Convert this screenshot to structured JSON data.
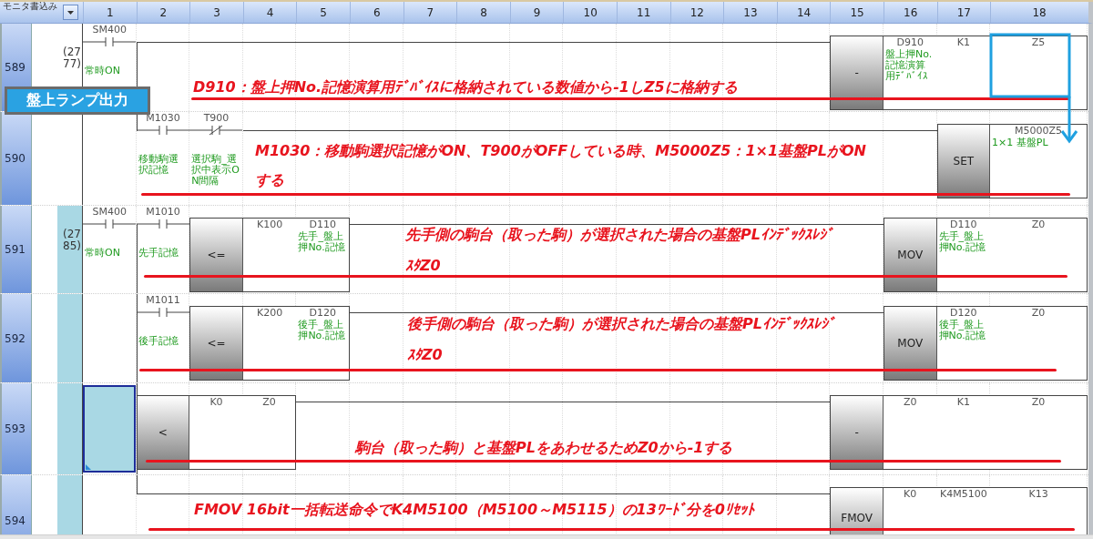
{
  "header": {
    "mode_label": "モニタ書込み",
    "columns": [
      "1",
      "2",
      "3",
      "4",
      "5",
      "6",
      "7",
      "8",
      "9",
      "10",
      "11",
      "12",
      "13",
      "14",
      "15",
      "16",
      "17",
      "18"
    ]
  },
  "section_label": "盤上ランプ出力",
  "rungs": [
    {
      "number": "589",
      "step": "(2777)",
      "step_band": false,
      "cursor": false,
      "joins_previous": false,
      "elements": [
        {
          "kind": "contact",
          "device": "SM400",
          "comment": "常時ON",
          "normally_closed": false
        },
        {
          "kind": "instruction",
          "op": "-",
          "operands": [
            {
              "device": "D910",
              "comment": "盤上押No.記憶演算用ﾃﾞﾊﾞｲｽ"
            },
            {
              "device": "K1"
            },
            {
              "device": "Z5"
            }
          ]
        }
      ],
      "note": [
        "D910：盤上押No.記憶演算用ﾃﾞﾊﾞｲｽに格納されている数値から-1しZ5に格納する"
      ]
    },
    {
      "number": "590",
      "step_band": false,
      "cursor": false,
      "joins_previous": true,
      "elements": [
        {
          "kind": "contact",
          "device": "M1030",
          "comment": "移動駒選択記憶",
          "normally_closed": false
        },
        {
          "kind": "contact",
          "device": "T900",
          "comment": "選択駒_選択中表示ON間隔",
          "normally_closed": true
        },
        {
          "kind": "instruction",
          "op": "SET",
          "operands": [
            {
              "device": "M5000Z5",
              "comment": "1×1 基盤PL"
            }
          ]
        }
      ],
      "note": [
        "M1030：移動駒選択記憶がON、T900がOFFしている時、M5000Z5：1×1基盤PLがON",
        "する"
      ]
    },
    {
      "number": "591",
      "step": "(2785)",
      "step_band": true,
      "cursor": false,
      "joins_previous": false,
      "elements": [
        {
          "kind": "contact",
          "device": "SM400",
          "comment": "常時ON",
          "normally_closed": false
        },
        {
          "kind": "contact",
          "device": "M1010",
          "comment": "先手記憶",
          "normally_closed": false
        },
        {
          "kind": "instruction",
          "op": "<=",
          "operands": [
            {
              "device": "K100"
            },
            {
              "device": "D110",
              "comment": "先手_盤上押No.記憶"
            }
          ]
        },
        {
          "kind": "instruction",
          "op": "MOV",
          "operands": [
            {
              "device": "D110",
              "comment": "先手_盤上押No.記憶"
            },
            {
              "device": "Z0"
            }
          ]
        }
      ],
      "note": [
        "先手側の駒台（取った駒）が選択された場合の基盤PLｲﾝﾃﾞｯｸｽﾚｼﾞ",
        "ｽﾀZ0"
      ]
    },
    {
      "number": "592",
      "step_band": true,
      "cursor": false,
      "joins_previous": true,
      "elements": [
        {
          "kind": "contact",
          "device": "M1011",
          "comment": "後手記憶",
          "normally_closed": false
        },
        {
          "kind": "instruction",
          "op": "<=",
          "operands": [
            {
              "device": "K200"
            },
            {
              "device": "D120",
              "comment": "後手_盤上押No.記憶"
            }
          ]
        },
        {
          "kind": "instruction",
          "op": "MOV",
          "operands": [
            {
              "device": "D120",
              "comment": "後手_盤上押No.記憶"
            },
            {
              "device": "Z0"
            }
          ]
        }
      ],
      "note": [
        "後手側の駒台（取った駒）が選択された場合の基盤PLｲﾝﾃﾞｯｸｽﾚｼﾞ",
        "ｽﾀZ0"
      ]
    },
    {
      "number": "593",
      "step_band": true,
      "cursor": true,
      "joins_previous": true,
      "elements": [
        {
          "kind": "instruction",
          "op": "<",
          "operands": [
            {
              "device": "K0"
            },
            {
              "device": "Z0"
            }
          ]
        },
        {
          "kind": "instruction",
          "op": "-",
          "operands": [
            {
              "device": "Z0"
            },
            {
              "device": "K1"
            },
            {
              "device": "Z0"
            }
          ]
        }
      ],
      "note": [
        "駒台（取った駒）と基盤PLをあわせるためZ0から-1する"
      ]
    },
    {
      "number": "594",
      "step_band": true,
      "cursor": false,
      "joins_previous": true,
      "elements": [
        {
          "kind": "instruction",
          "op": "FMOV",
          "operands": [
            {
              "device": "K0"
            },
            {
              "device": "K4M5100"
            },
            {
              "device": "K13"
            }
          ]
        }
      ],
      "note": [
        "FMOV 16bit一括転送命令でK4M5100（M5100～M5115）の13ﾜｰﾄﾞ分を0ﾘｾｯﾄ"
      ]
    }
  ]
}
